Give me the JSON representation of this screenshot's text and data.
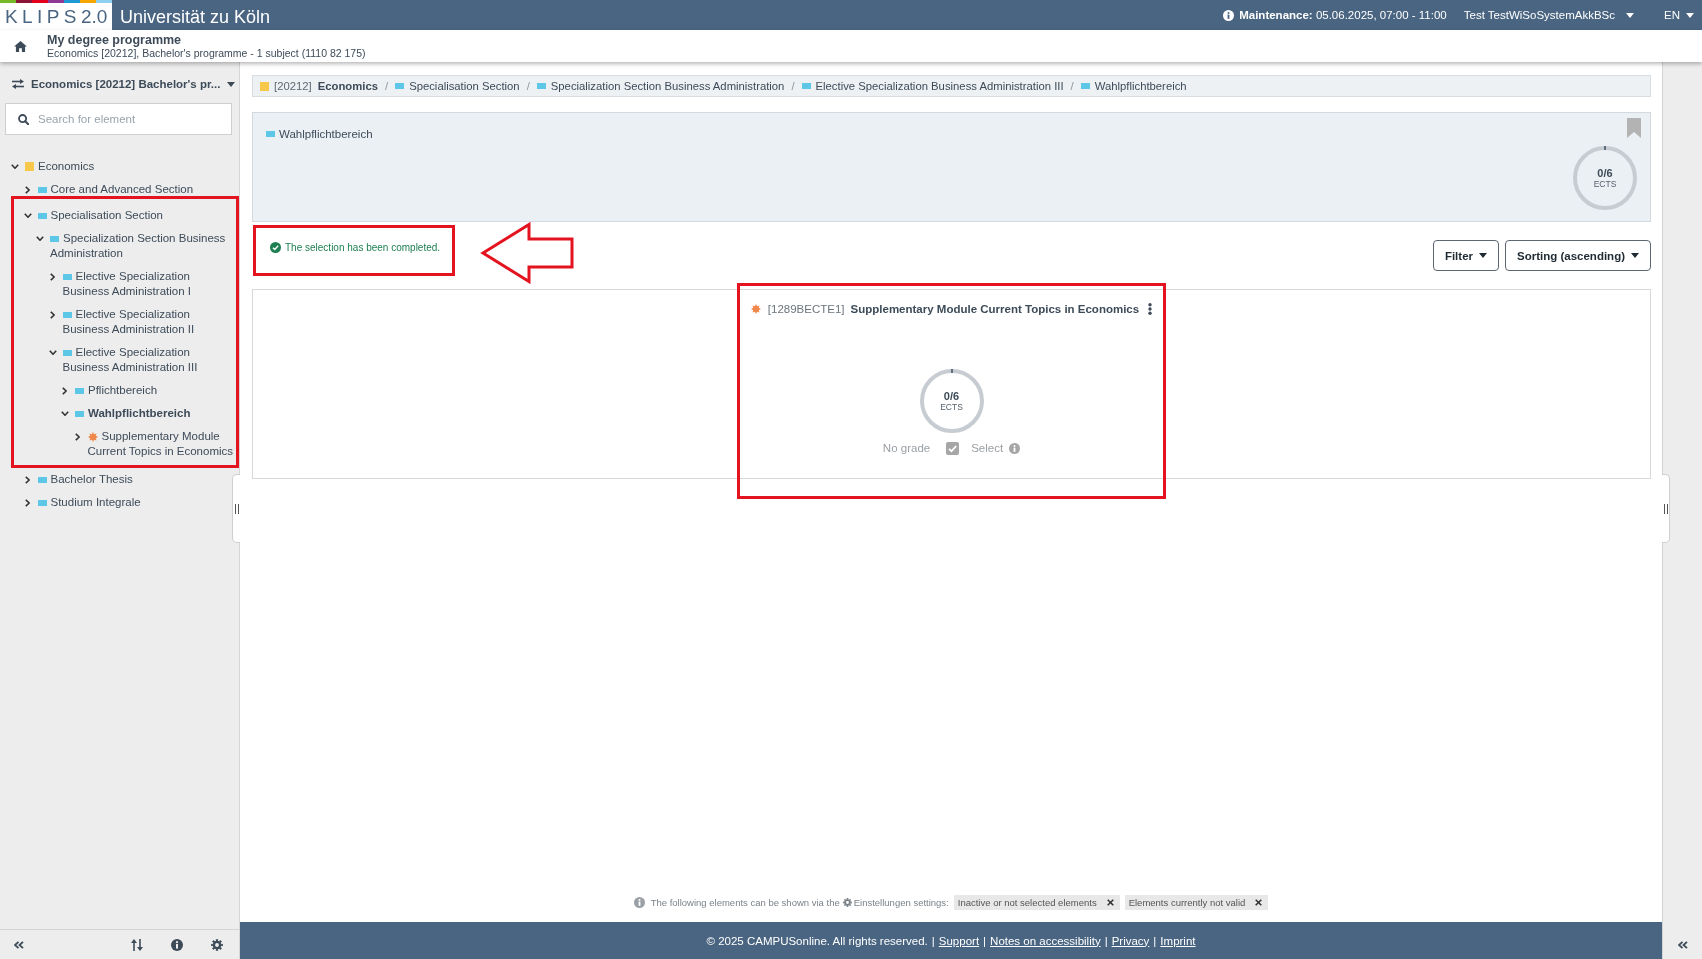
{
  "top_bar": {
    "logo": {
      "name": "KLIPS",
      "version": "2.0"
    },
    "university": "Universität zu Köln",
    "maintenance": "**Maintenance:** 05.06.2025, 07:00 - 11:00",
    "user": "Test TestWiSoSystemAkkBSc",
    "language": "EN"
  },
  "header": {
    "title": "My degree programme",
    "subtitle": "Economics [20212], Bachelor's programme - 1 subject (1110 82 175)"
  },
  "sidebar": {
    "programme": "Economics [20212] Bachelor's pr...",
    "search": {
      "placeholder": "Search for element"
    },
    "tree": [
      {
        "kind": "programme",
        "label": "Economics",
        "expanded": true,
        "selected": false,
        "highlighted": false,
        "children": [
          {
            "kind": "section",
            "label": "Core and Advanced Section",
            "expanded": false,
            "selected": false,
            "highlighted": false
          },
          {
            "kind": "section",
            "label": "Specialisation Section",
            "expanded": true,
            "selected": false,
            "highlighted": true,
            "children": [
              {
                "kind": "section",
                "label": "Specialization Section Business Administration",
                "expanded": true,
                "selected": false,
                "highlighted": false,
                "children": [
                  {
                    "kind": "section",
                    "label": "Elective Specialization Business Administration I",
                    "expanded": false,
                    "selected": false,
                    "highlighted": false
                  },
                  {
                    "kind": "section",
                    "label": "Elective Specialization Business Administration II",
                    "expanded": false,
                    "selected": false,
                    "highlighted": false
                  },
                  {
                    "kind": "section",
                    "label": "Elective Specialization Business Administration III",
                    "expanded": true,
                    "selected": false,
                    "highlighted": false,
                    "children": [
                      {
                        "kind": "section",
                        "label": "Pflichtbereich",
                        "expanded": false,
                        "selected": false,
                        "highlighted": false
                      },
                      {
                        "kind": "section",
                        "label": "Wahlpflichtbereich",
                        "expanded": true,
                        "selected": true,
                        "highlighted": false,
                        "children": [
                          {
                            "kind": "module",
                            "label": "Supplementary Module Current Topics in Economics",
                            "expanded": false,
                            "selected": false,
                            "highlighted": false
                          }
                        ]
                      }
                    ]
                  }
                ]
              }
            ]
          },
          {
            "kind": "section",
            "label": "Bachelor Thesis",
            "expanded": false,
            "selected": false,
            "highlighted": false
          },
          {
            "kind": "section",
            "label": "Studium Integrale",
            "expanded": false,
            "selected": false,
            "highlighted": false
          }
        ]
      }
    ]
  },
  "breadcrumb": {
    "separator": "/",
    "items": [
      {
        "kind": "programme",
        "code": "[20212]",
        "label": "Economics"
      },
      {
        "kind": "section",
        "label": "Specialisation Section"
      },
      {
        "kind": "section",
        "label": "Specialization Section Business Administration"
      },
      {
        "kind": "section",
        "label": "Elective Specialization Business Administration III"
      },
      {
        "kind": "section",
        "label": "Wahlpflichtbereich"
      }
    ]
  },
  "element_header": {
    "kind": "section",
    "title": "Wahlpflichtbereich",
    "ects": {
      "value": "0/6",
      "unit": "ECTS"
    }
  },
  "notice": {
    "text": "The selection has been completed.",
    "highlighted": true,
    "arrow": true
  },
  "toolbar": {
    "buttons": [
      "Filter",
      "Sorting (ascending)"
    ]
  },
  "modules": [
    {
      "kind": "module",
      "code": "[1289BECTE1]",
      "title": "Supplementary Module Current Topics in Economics",
      "highlighted": true,
      "ects": {
        "value": "0/6",
        "unit": "ECTS"
      },
      "grade": "No grade",
      "select": {
        "label": "Select",
        "checked": true
      }
    }
  ],
  "hint": {
    "lead": "The following elements can be shown via the",
    "settings": "Einstellungen settings:",
    "chips": [
      "Inactive or not selected elements",
      "Elements currently not valid"
    ]
  },
  "footer": {
    "copyright": "© 2025 CAMPUSonline. All rights reserved.",
    "separator": "|",
    "links": [
      "Support",
      "Notes on accessibility",
      "Privacy",
      "Imprint"
    ]
  }
}
